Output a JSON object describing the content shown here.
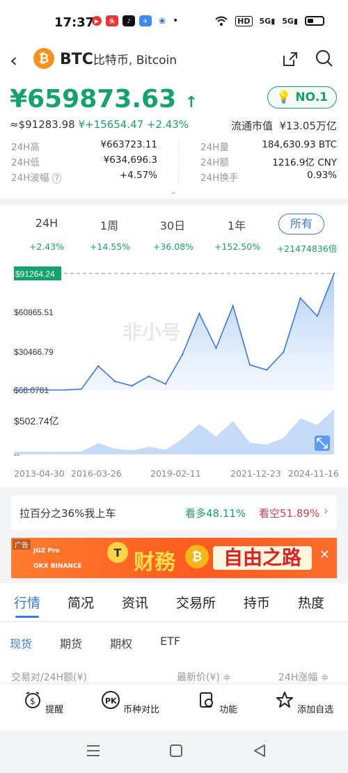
{
  "status": {
    "time": "17:37",
    "signal_labels": [
      "HD",
      "5G",
      "5G"
    ]
  },
  "header": {
    "coin_symbol": "BTC",
    "coin_name": "比特币, Bitcoin",
    "logo_letter": "₿"
  },
  "price": {
    "value": "¥659873.63",
    "rank": "NO.1",
    "usd_line": "≈$91283.98",
    "change": "¥+15654.47 +2.43%",
    "market_cap_label": "流通市值",
    "market_cap_value": "¥13.05万亿",
    "stats": [
      {
        "k": "24H高",
        "v": "¥663723.11"
      },
      {
        "k": "24H低",
        "v": "¥634,696.3"
      },
      {
        "k": "24H波幅",
        "v": "+4.57%"
      },
      {
        "k": "24H量",
        "v": "184,630.93 BTC"
      },
      {
        "k": "24H额",
        "v": "1216.9亿 CNY"
      },
      {
        "k": "24H换手",
        "v": "0.93%"
      }
    ]
  },
  "periods": [
    {
      "label": "24H",
      "change": "+2.43%"
    },
    {
      "label": "1周",
      "change": "+14.55%"
    },
    {
      "label": "30日",
      "change": "+36.08%"
    },
    {
      "label": "1年",
      "change": "+152.50%"
    },
    {
      "label": "所有",
      "change": "+21474836倍"
    }
  ],
  "chart_data": {
    "type": "area",
    "title": "",
    "y_ticks": [
      "$91264.24",
      "$60865.51",
      "$30466.79",
      "$68.0781"
    ],
    "volume_label": "$502.74亿",
    "volume_min_label": "--",
    "x_ticks": [
      "2013-04-30",
      "2016-03-26",
      "2019-02-11",
      "2021-12-23",
      "2024-11-16"
    ],
    "ylim": [
      68.0781,
      91264.24
    ],
    "watermark": "非小号",
    "x": [
      "2013-04",
      "2014-01",
      "2015-01",
      "2016-03",
      "2017-01",
      "2017-12",
      "2018-06",
      "2019-02",
      "2019-06",
      "2020-03",
      "2020-12",
      "2021-04",
      "2021-07",
      "2021-11",
      "2022-06",
      "2022-12",
      "2023-06",
      "2024-03",
      "2024-08",
      "2024-11"
    ],
    "values": [
      100,
      800,
      300,
      400,
      1000,
      19000,
      7000,
      3600,
      11000,
      5000,
      28000,
      60000,
      33000,
      66000,
      20000,
      16000,
      30000,
      72000,
      58000,
      91264
    ],
    "accent": "#3878e8"
  },
  "sentiment": {
    "label": "拉百分之36%我上车",
    "bull": "看多48.11%",
    "bear": "看空51.89%"
  },
  "ad": {
    "tag": "广告",
    "brand1": "JGZ Pro",
    "brand2": "OKX  BINANCE",
    "text1": "财務",
    "text2": "自由之路"
  },
  "main_tabs": [
    "行情",
    "简况",
    "资讯",
    "交易所",
    "持币",
    "热度"
  ],
  "sub_tabs": [
    "现货",
    "期货",
    "期权",
    "ETF"
  ],
  "columns": [
    "交易对/24H额(¥)",
    "最新价(¥) ≑",
    "24H涨幅 ≑"
  ],
  "bottom_actions": [
    "提醒",
    "币种对比",
    "功能",
    "添加自选"
  ]
}
